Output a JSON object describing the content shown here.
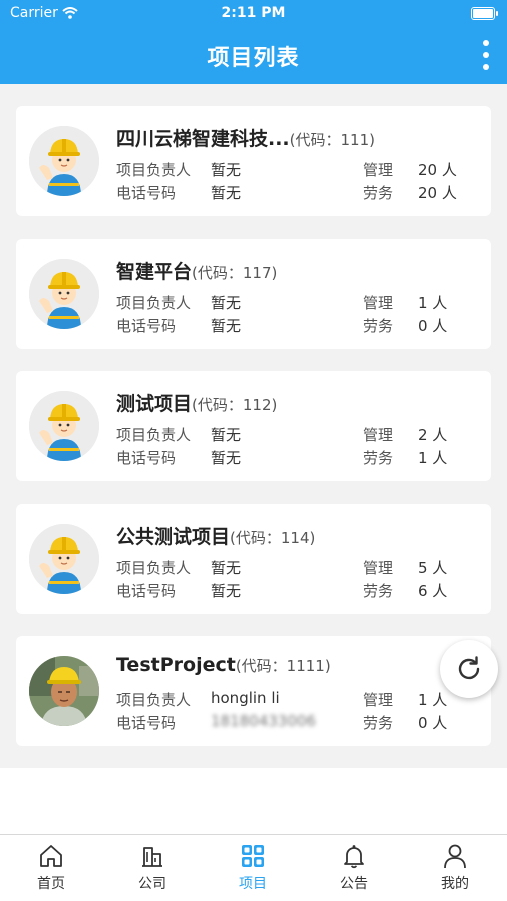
{
  "status_bar": {
    "carrier": "Carrier",
    "time": "2:11 PM"
  },
  "header": {
    "title": "项目列表"
  },
  "labels": {
    "leader": "项目负责人",
    "phone": "电话号码",
    "management": "管理",
    "labor": "劳务"
  },
  "projects": [
    {
      "name": "四川云梯智建科技...",
      "code": "(代码：111)",
      "leader": "暂无",
      "phone": "暂无",
      "management": "20 人",
      "labor": "20 人"
    },
    {
      "name": "智建平台",
      "code": "(代码：117)",
      "leader": "暂无",
      "phone": "暂无",
      "management": "1 人",
      "labor": "0 人"
    },
    {
      "name": "测试项目",
      "code": "(代码：112)",
      "leader": "暂无",
      "phone": "暂无",
      "management": "2 人",
      "labor": "1 人"
    },
    {
      "name": "公共测试项目",
      "code": "(代码：114)",
      "leader": "暂无",
      "phone": "暂无",
      "management": "5 人",
      "labor": "6 人"
    },
    {
      "name": "TestProject",
      "code": "(代码：1111)",
      "leader": "honglin li",
      "phone": "18180433006",
      "management": "1 人",
      "labor": "0 人"
    }
  ],
  "tabs": [
    {
      "label": "首页",
      "icon": "home-icon",
      "active": false
    },
    {
      "label": "公司",
      "icon": "company-icon",
      "active": false
    },
    {
      "label": "项目",
      "icon": "project-grid-icon",
      "active": true
    },
    {
      "label": "公告",
      "icon": "bell-icon",
      "active": false
    },
    {
      "label": "我的",
      "icon": "user-icon",
      "active": false
    }
  ],
  "colors": {
    "primary": "#2aa3f0",
    "background": "#f2f2f2",
    "card": "#ffffff"
  }
}
